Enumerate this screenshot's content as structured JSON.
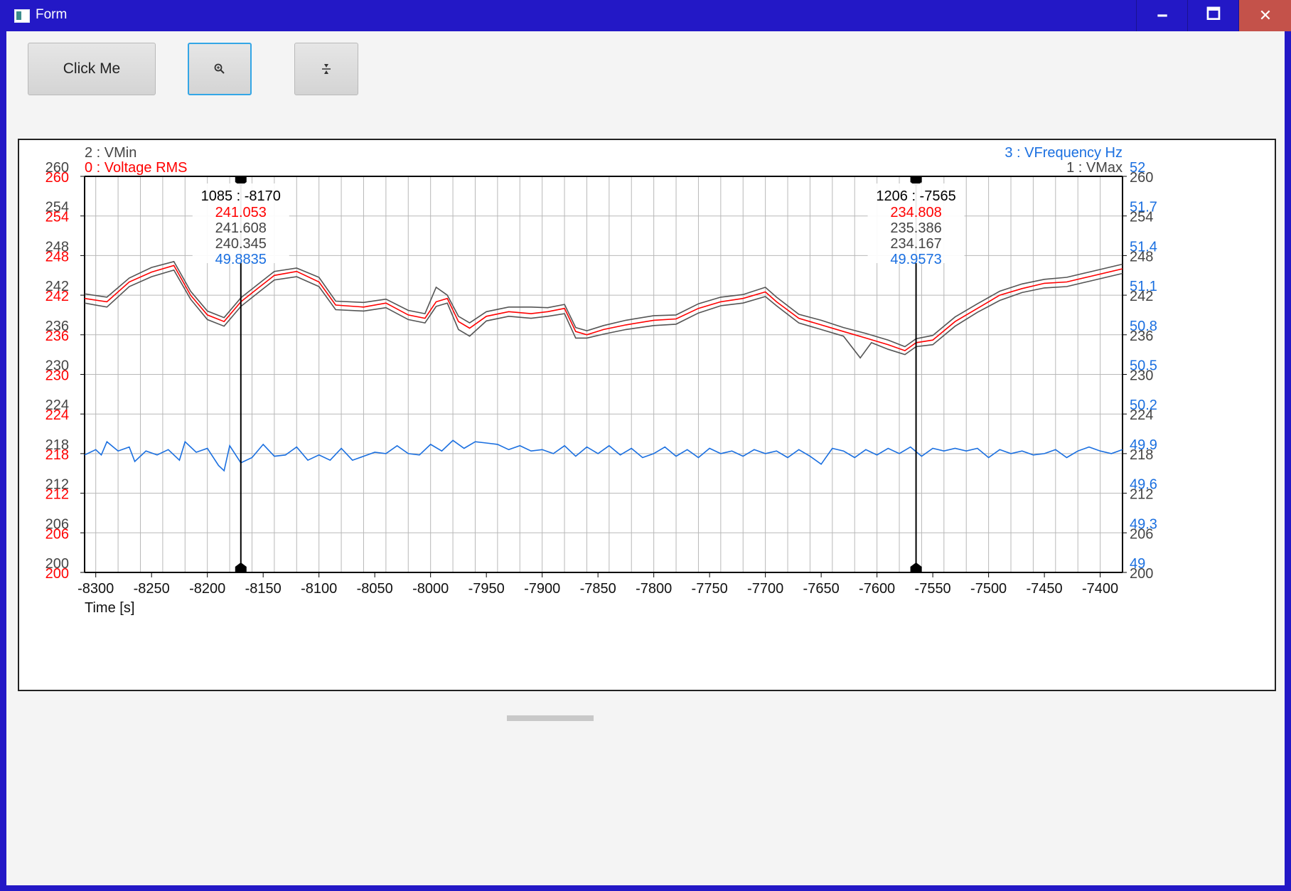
{
  "window": {
    "title": "Form",
    "icon": "app-form-icon",
    "controls": {
      "minimize": "🗕",
      "maximize": "🗖",
      "close": "✕"
    },
    "accent": "#2318c6"
  },
  "toolbar": {
    "click_label": "Click Me",
    "zoom_icon": "🔍",
    "fit_icon": "÷"
  },
  "chart_data": {
    "type": "line",
    "xlabel": "Time [s]",
    "xlim": [
      -8310,
      -7380
    ],
    "x_ticks": [
      "-8300",
      "-8250",
      "-8200",
      "-8150",
      "-8100",
      "-8050",
      "-8000",
      "-7950",
      "-7900",
      "-7850",
      "-7800",
      "-7750",
      "-7700",
      "-7650",
      "-7600",
      "-7550",
      "-7500",
      "-7450",
      "-7400"
    ],
    "grid": true,
    "legend": {
      "top_left": [
        "2 : VMin",
        "0 : Voltage RMS"
      ],
      "top_right": [
        "3 : VFrequency Hz",
        "1 : VMax"
      ]
    },
    "y_axes": {
      "left_gray": {
        "ticks": [
          "260",
          "254",
          "248",
          "242",
          "236",
          "230",
          "224",
          "218",
          "212",
          "206",
          "200"
        ],
        "color": "#444444"
      },
      "left_red": {
        "ticks": [
          "260",
          "254",
          "248",
          "242",
          "236",
          "230",
          "224",
          "218",
          "212",
          "206",
          "200"
        ],
        "color": "#ff0000"
      },
      "right_gray": {
        "ticks": [
          "260",
          "254",
          "248",
          "242",
          "236",
          "230",
          "224",
          "218",
          "212",
          "206",
          "200"
        ],
        "color": "#444444"
      },
      "right_blue": {
        "ticks": [
          "52",
          "51.7",
          "51.4",
          "51.1",
          "50.8",
          "50.5",
          "50.2",
          "49.9",
          "49.6",
          "49.3",
          "49"
        ],
        "color": "#1a6fe0"
      }
    },
    "ylim_voltage": [
      200,
      260
    ],
    "ylim_frequency": [
      49,
      52
    ],
    "series": [
      {
        "name": "0 : Voltage RMS",
        "color": "#ff0000",
        "axis": "voltage",
        "points": [
          [
            -8310,
            241.5
          ],
          [
            -8290,
            241
          ],
          [
            -8270,
            244
          ],
          [
            -8250,
            245.5
          ],
          [
            -8230,
            246.5
          ],
          [
            -8215,
            242
          ],
          [
            -8200,
            239
          ],
          [
            -8185,
            238
          ],
          [
            -8170,
            241
          ],
          [
            -8155,
            243
          ],
          [
            -8140,
            245
          ],
          [
            -8120,
            245.6
          ],
          [
            -8100,
            244
          ],
          [
            -8085,
            240.5
          ],
          [
            -8060,
            240.2
          ],
          [
            -8040,
            240.8
          ],
          [
            -8020,
            239
          ],
          [
            -8005,
            238.5
          ],
          [
            -7995,
            241
          ],
          [
            -7985,
            241.5
          ],
          [
            -7975,
            238
          ],
          [
            -7965,
            237
          ],
          [
            -7950,
            238.8
          ],
          [
            -7930,
            239.5
          ],
          [
            -7910,
            239.2
          ],
          [
            -7895,
            239.5
          ],
          [
            -7880,
            240
          ],
          [
            -7870,
            236.5
          ],
          [
            -7860,
            236
          ],
          [
            -7845,
            236.8
          ],
          [
            -7825,
            237.5
          ],
          [
            -7800,
            238.2
          ],
          [
            -7780,
            238.4
          ],
          [
            -7760,
            240
          ],
          [
            -7740,
            241
          ],
          [
            -7720,
            241.5
          ],
          [
            -7700,
            242.5
          ],
          [
            -7690,
            241
          ],
          [
            -7670,
            238.5
          ],
          [
            -7650,
            237.5
          ],
          [
            -7630,
            236.5
          ],
          [
            -7610,
            235.5
          ],
          [
            -7590,
            234.5
          ],
          [
            -7575,
            233.6
          ],
          [
            -7565,
            234.8
          ],
          [
            -7550,
            235.2
          ],
          [
            -7530,
            238
          ],
          [
            -7510,
            240
          ],
          [
            -7490,
            242
          ],
          [
            -7470,
            243
          ],
          [
            -7450,
            243.8
          ],
          [
            -7430,
            244
          ],
          [
            -7410,
            244.8
          ],
          [
            -7380,
            246
          ]
        ]
      },
      {
        "name": "1 : VMax",
        "color": "#555555",
        "axis": "voltage",
        "points": [
          [
            -8310,
            242.2
          ],
          [
            -8290,
            241.7
          ],
          [
            -8270,
            244.6
          ],
          [
            -8250,
            246.2
          ],
          [
            -8230,
            247.1
          ],
          [
            -8215,
            242.6
          ],
          [
            -8200,
            239.6
          ],
          [
            -8185,
            238.6
          ],
          [
            -8170,
            241.6
          ],
          [
            -8155,
            243.6
          ],
          [
            -8140,
            245.6
          ],
          [
            -8120,
            246.1
          ],
          [
            -8100,
            244.7
          ],
          [
            -8085,
            241.1
          ],
          [
            -8060,
            240.9
          ],
          [
            -8040,
            241.4
          ],
          [
            -8020,
            239.7
          ],
          [
            -8005,
            239.2
          ],
          [
            -7995,
            243.2
          ],
          [
            -7985,
            242
          ],
          [
            -7975,
            238.8
          ],
          [
            -7965,
            237.8
          ],
          [
            -7950,
            239.5
          ],
          [
            -7930,
            240.2
          ],
          [
            -7910,
            240.2
          ],
          [
            -7895,
            240.1
          ],
          [
            -7880,
            240.6
          ],
          [
            -7870,
            237.1
          ],
          [
            -7860,
            236.6
          ],
          [
            -7845,
            237.4
          ],
          [
            -7825,
            238.2
          ],
          [
            -7800,
            238.9
          ],
          [
            -7780,
            239
          ],
          [
            -7760,
            240.7
          ],
          [
            -7740,
            241.7
          ],
          [
            -7720,
            242.1
          ],
          [
            -7700,
            243.2
          ],
          [
            -7690,
            241.7
          ],
          [
            -7670,
            239.1
          ],
          [
            -7650,
            238.2
          ],
          [
            -7630,
            237.1
          ],
          [
            -7610,
            236.2
          ],
          [
            -7590,
            235.2
          ],
          [
            -7575,
            234.2
          ],
          [
            -7565,
            235.4
          ],
          [
            -7550,
            235.9
          ],
          [
            -7530,
            238.7
          ],
          [
            -7510,
            240.7
          ],
          [
            -7490,
            242.6
          ],
          [
            -7470,
            243.7
          ],
          [
            -7450,
            244.4
          ],
          [
            -7430,
            244.7
          ],
          [
            -7410,
            245.5
          ],
          [
            -7380,
            246.7
          ]
        ]
      },
      {
        "name": "2 : VMin",
        "color": "#555555",
        "axis": "voltage",
        "points": [
          [
            -8310,
            240.8
          ],
          [
            -8290,
            240.2
          ],
          [
            -8270,
            243.3
          ],
          [
            -8250,
            244.8
          ],
          [
            -8230,
            245.8
          ],
          [
            -8215,
            241.4
          ],
          [
            -8200,
            238.3
          ],
          [
            -8185,
            237.3
          ],
          [
            -8170,
            240.3
          ],
          [
            -8155,
            242.3
          ],
          [
            -8140,
            244.3
          ],
          [
            -8120,
            244.8
          ],
          [
            -8100,
            243.3
          ],
          [
            -8085,
            239.8
          ],
          [
            -8060,
            239.6
          ],
          [
            -8040,
            240.1
          ],
          [
            -8020,
            238.3
          ],
          [
            -8005,
            237.8
          ],
          [
            -7995,
            240.3
          ],
          [
            -7985,
            240.8
          ],
          [
            -7975,
            236.8
          ],
          [
            -7965,
            235.8
          ],
          [
            -7950,
            238.1
          ],
          [
            -7930,
            238.8
          ],
          [
            -7910,
            238.5
          ],
          [
            -7895,
            238.8
          ],
          [
            -7880,
            239.2
          ],
          [
            -7870,
            235.5
          ],
          [
            -7860,
            235.5
          ],
          [
            -7845,
            236.1
          ],
          [
            -7825,
            236.8
          ],
          [
            -7800,
            237.4
          ],
          [
            -7780,
            237.6
          ],
          [
            -7760,
            239.3
          ],
          [
            -7740,
            240.4
          ],
          [
            -7720,
            240.8
          ],
          [
            -7700,
            241.8
          ],
          [
            -7690,
            240.4
          ],
          [
            -7670,
            237.8
          ],
          [
            -7650,
            236.8
          ],
          [
            -7630,
            235.8
          ],
          [
            -7615,
            232.5
          ],
          [
            -7605,
            234.8
          ],
          [
            -7590,
            233.8
          ],
          [
            -7575,
            233
          ],
          [
            -7565,
            234.2
          ],
          [
            -7550,
            234.5
          ],
          [
            -7530,
            237.3
          ],
          [
            -7510,
            239.4
          ],
          [
            -7490,
            241.2
          ],
          [
            -7470,
            242.4
          ],
          [
            -7450,
            243.1
          ],
          [
            -7430,
            243.3
          ],
          [
            -7410,
            244.1
          ],
          [
            -7380,
            245.3
          ]
        ]
      },
      {
        "name": "3 : VFrequency Hz",
        "color": "#1a6fe0",
        "axis": "frequency",
        "points": [
          [
            -8310,
            49.89
          ],
          [
            -8300,
            49.93
          ],
          [
            -8295,
            49.89
          ],
          [
            -8290,
            49.99
          ],
          [
            -8280,
            49.92
          ],
          [
            -8270,
            49.95
          ],
          [
            -8265,
            49.84
          ],
          [
            -8255,
            49.92
          ],
          [
            -8245,
            49.89
          ],
          [
            -8235,
            49.93
          ],
          [
            -8225,
            49.85
          ],
          [
            -8220,
            49.99
          ],
          [
            -8210,
            49.91
          ],
          [
            -8200,
            49.94
          ],
          [
            -8190,
            49.81
          ],
          [
            -8185,
            49.77
          ],
          [
            -8180,
            49.96
          ],
          [
            -8170,
            49.83
          ],
          [
            -8160,
            49.87
          ],
          [
            -8150,
            49.97
          ],
          [
            -8140,
            49.88
          ],
          [
            -8130,
            49.89
          ],
          [
            -8120,
            49.95
          ],
          [
            -8110,
            49.85
          ],
          [
            -8100,
            49.89
          ],
          [
            -8090,
            49.85
          ],
          [
            -8080,
            49.94
          ],
          [
            -8070,
            49.85
          ],
          [
            -8060,
            49.88
          ],
          [
            -8050,
            49.91
          ],
          [
            -8040,
            49.9
          ],
          [
            -8030,
            49.96
          ],
          [
            -8020,
            49.9
          ],
          [
            -8010,
            49.89
          ],
          [
            -8000,
            49.97
          ],
          [
            -7990,
            49.92
          ],
          [
            -7980,
            50.0
          ],
          [
            -7970,
            49.94
          ],
          [
            -7960,
            49.99
          ],
          [
            -7950,
            49.98
          ],
          [
            -7940,
            49.97
          ],
          [
            -7930,
            49.93
          ],
          [
            -7920,
            49.96
          ],
          [
            -7910,
            49.92
          ],
          [
            -7900,
            49.93
          ],
          [
            -7890,
            49.9
          ],
          [
            -7880,
            49.96
          ],
          [
            -7870,
            49.88
          ],
          [
            -7860,
            49.95
          ],
          [
            -7850,
            49.9
          ],
          [
            -7840,
            49.96
          ],
          [
            -7830,
            49.89
          ],
          [
            -7820,
            49.94
          ],
          [
            -7810,
            49.87
          ],
          [
            -7800,
            49.9
          ],
          [
            -7790,
            49.95
          ],
          [
            -7780,
            49.88
          ],
          [
            -7770,
            49.93
          ],
          [
            -7760,
            49.87
          ],
          [
            -7750,
            49.94
          ],
          [
            -7740,
            49.9
          ],
          [
            -7730,
            49.92
          ],
          [
            -7720,
            49.88
          ],
          [
            -7710,
            49.93
          ],
          [
            -7700,
            49.9
          ],
          [
            -7690,
            49.92
          ],
          [
            -7680,
            49.87
          ],
          [
            -7670,
            49.93
          ],
          [
            -7660,
            49.88
          ],
          [
            -7650,
            49.82
          ],
          [
            -7640,
            49.94
          ],
          [
            -7630,
            49.92
          ],
          [
            -7620,
            49.87
          ],
          [
            -7610,
            49.93
          ],
          [
            -7600,
            49.89
          ],
          [
            -7590,
            49.94
          ],
          [
            -7580,
            49.9
          ],
          [
            -7570,
            49.95
          ],
          [
            -7560,
            49.88
          ],
          [
            -7550,
            49.94
          ],
          [
            -7540,
            49.92
          ],
          [
            -7530,
            49.94
          ],
          [
            -7520,
            49.92
          ],
          [
            -7510,
            49.94
          ],
          [
            -7500,
            49.87
          ],
          [
            -7490,
            49.93
          ],
          [
            -7480,
            49.9
          ],
          [
            -7470,
            49.92
          ],
          [
            -7460,
            49.89
          ],
          [
            -7450,
            49.9
          ],
          [
            -7440,
            49.93
          ],
          [
            -7430,
            49.87
          ],
          [
            -7420,
            49.92
          ],
          [
            -7410,
            49.95
          ],
          [
            -7400,
            49.92
          ],
          [
            -7390,
            49.9
          ],
          [
            -7380,
            49.93
          ]
        ]
      }
    ],
    "cursors": [
      {
        "x": -8170,
        "label": "1085 : -8170",
        "values": [
          "241.053",
          "241.608",
          "240.345",
          "49.8835"
        ]
      },
      {
        "x": -7565,
        "label": "1206 : -7565",
        "values": [
          "234.808",
          "235.386",
          "234.167",
          "49.9573"
        ]
      }
    ]
  }
}
